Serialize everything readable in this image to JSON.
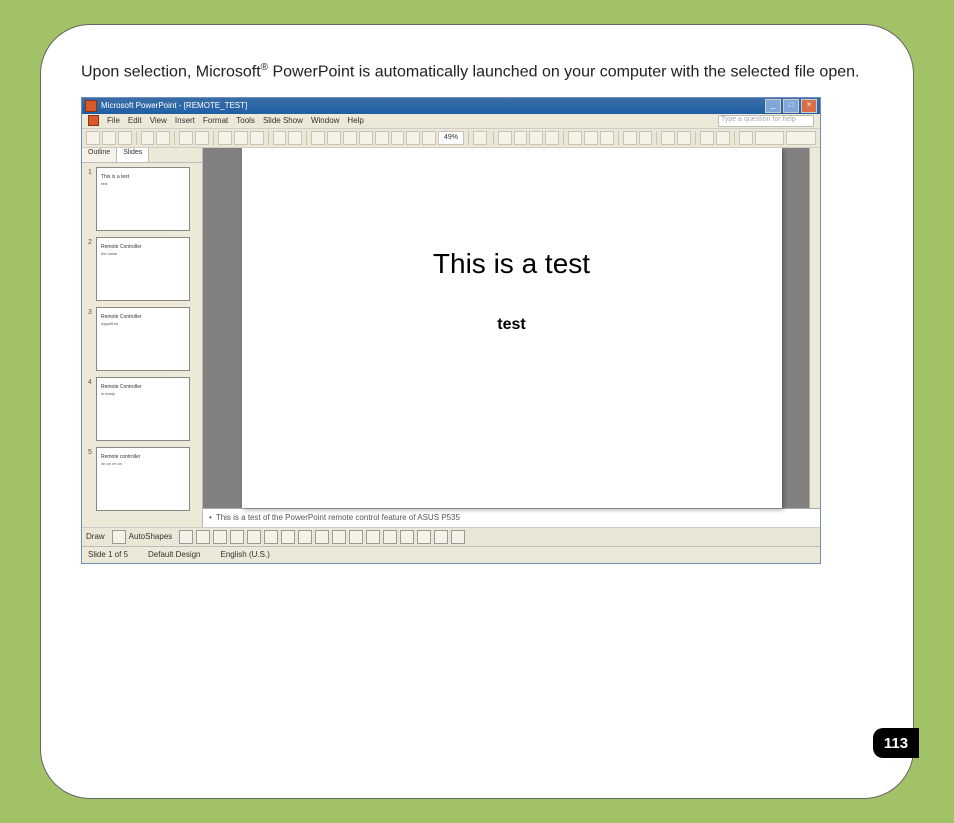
{
  "doc": {
    "intro_pre": "Upon selection, Microsoft",
    "reg": "®",
    "intro_post": " PowerPoint is automatically launched on your computer with the selected file open.",
    "page_number": "113"
  },
  "ppt": {
    "title": "Microsoft PowerPoint - [REMOTE_TEST]",
    "menu": [
      "File",
      "Edit",
      "View",
      "Insert",
      "Format",
      "Tools",
      "Slide Show",
      "Window",
      "Help"
    ],
    "type_question": "Type a question for help",
    "zoom": "49%",
    "side_tabs": {
      "outline": "Outline",
      "slides": "Slides"
    },
    "thumbs": [
      {
        "n": "1",
        "t1": "This is a test",
        "t2": "test"
      },
      {
        "n": "2",
        "t1": "Remote Controller",
        "t2": "the value"
      },
      {
        "n": "3",
        "t1": "Remote Controller",
        "t2": "Algorithm"
      },
      {
        "n": "4",
        "t1": "Remote Controller",
        "t2": "is ready"
      },
      {
        "n": "5",
        "t1": "Remote controller",
        "t2": "on on on on"
      }
    ],
    "main_slide": {
      "title": "This is a test",
      "sub": "test"
    },
    "notes": "This is a test of the PowerPoint remote control feature of ASUS P535",
    "drawbar_label": "Draw",
    "autoshapes": "AutoShapes",
    "status": {
      "slide": "Slide 1 of 5",
      "design": "Default Design",
      "lang": "English (U.S.)"
    }
  }
}
